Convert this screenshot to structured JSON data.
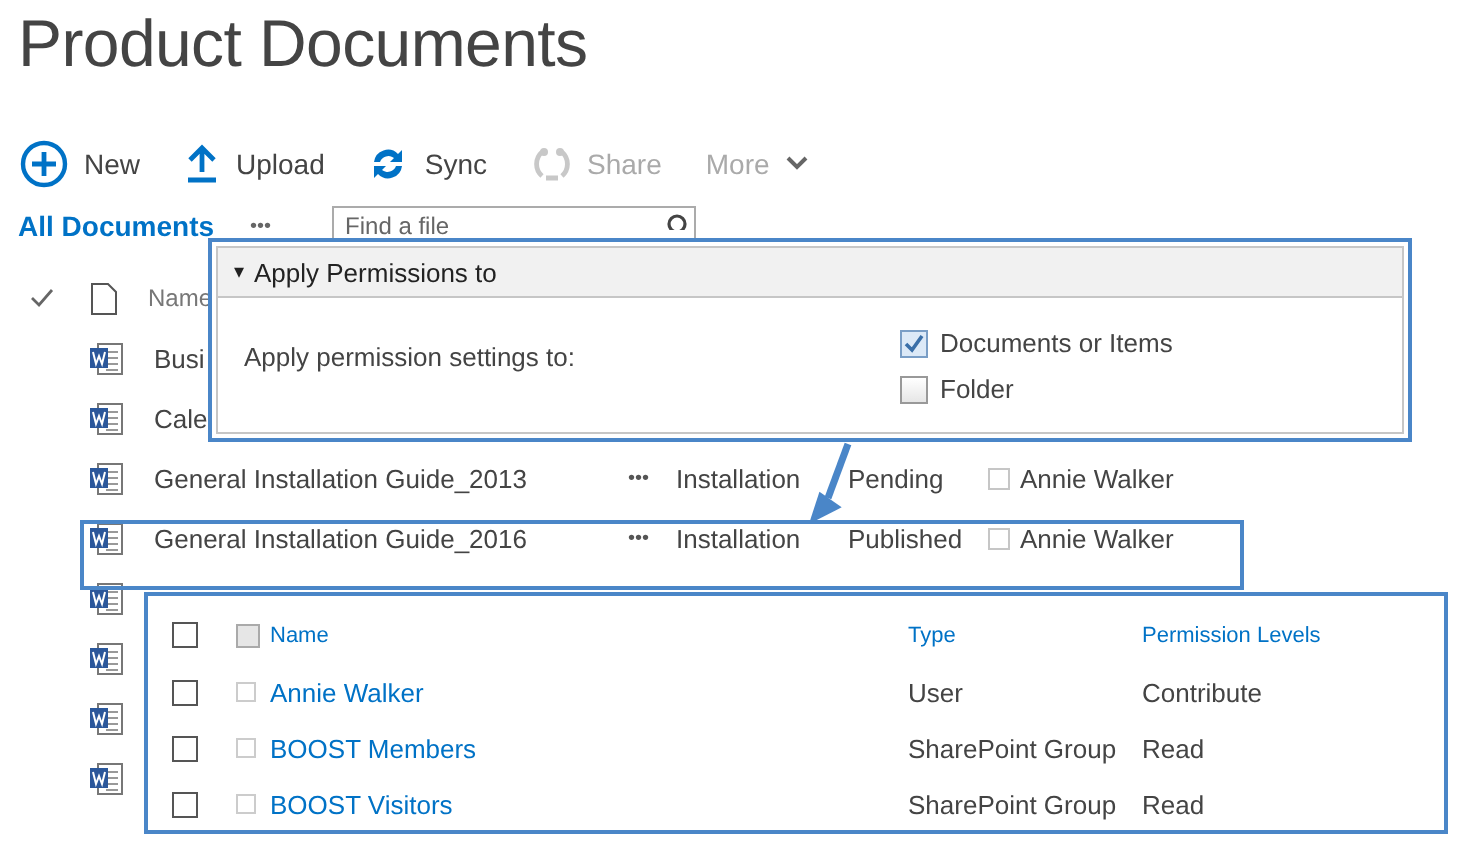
{
  "page_title": "Product Documents",
  "toolbar": [
    {
      "label": "New",
      "kind": "new",
      "disabled": false
    },
    {
      "label": "Upload",
      "kind": "upload",
      "disabled": false
    },
    {
      "label": "Sync",
      "kind": "sync",
      "disabled": false
    },
    {
      "label": "Share",
      "kind": "share",
      "disabled": true
    },
    {
      "label": "More",
      "kind": "more",
      "disabled": true
    }
  ],
  "view": {
    "label": "All Documents",
    "more": "•••"
  },
  "search": {
    "placeholder": "Find a file"
  },
  "list": {
    "header_name": "Name",
    "rows": [
      {
        "name": "Busi",
        "kind": "partial"
      },
      {
        "name": "Cale",
        "kind": "partial"
      },
      {
        "name": "General Installation Guide_2013",
        "kind": "full",
        "more": "•••",
        "category": "Installation",
        "status": "Pending",
        "owner": "Annie Walker"
      },
      {
        "name": "General Installation Guide_2016",
        "kind": "full",
        "more": "•••",
        "category": "Installation",
        "status": "Published",
        "owner": "Annie Walker"
      },
      {
        "kind": "icon_only"
      },
      {
        "kind": "icon_only"
      },
      {
        "kind": "icon_only"
      },
      {
        "kind": "icon_only"
      }
    ]
  },
  "apply_panel": {
    "title": "Apply Permissions to",
    "caret": "▾",
    "label": "Apply permission settings to:",
    "options": [
      {
        "label": "Documents or Items",
        "checked": true
      },
      {
        "label": "Folder",
        "checked": false
      }
    ]
  },
  "permissions": {
    "select_all": {
      "checked": false
    },
    "columns": [
      "Name",
      "Type",
      "Permission Levels"
    ],
    "rows": [
      {
        "name": "Annie Walker",
        "type": "User",
        "level": "Contribute",
        "checked": false
      },
      {
        "name": "BOOST Members",
        "type": "SharePoint Group",
        "level": "Read",
        "checked": false
      },
      {
        "name": "BOOST Visitors",
        "type": "SharePoint Group",
        "level": "Read",
        "checked": false
      }
    ]
  }
}
